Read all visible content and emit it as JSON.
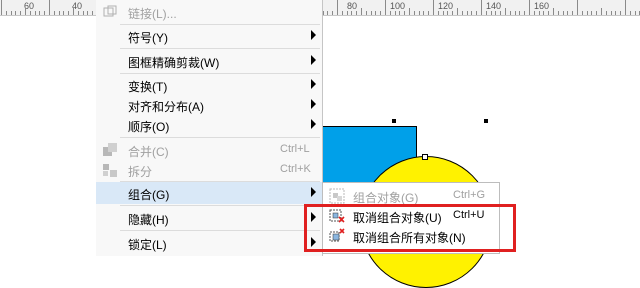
{
  "ruler": {
    "labels": [
      "60",
      "40",
      "80",
      "100",
      "120",
      "140",
      "160"
    ]
  },
  "menu": {
    "items": [
      {
        "label": "链接(L)..."
      },
      {
        "label": "符号(Y)"
      },
      {
        "label": "图框精确剪裁(W)"
      },
      {
        "label": "变换(T)"
      },
      {
        "label": "对齐和分布(A)"
      },
      {
        "label": "顺序(O)"
      },
      {
        "label": "合并(C)",
        "shortcut": "Ctrl+L"
      },
      {
        "label": "拆分",
        "shortcut": "Ctrl+K"
      },
      {
        "label": "组合(G)"
      },
      {
        "label": "隐藏(H)"
      },
      {
        "label": "锁定(L)"
      }
    ]
  },
  "submenu": {
    "items": [
      {
        "label": "组合对象(G)",
        "shortcut": "Ctrl+G"
      },
      {
        "label": "取消组合对象(U)",
        "shortcut": "Ctrl+U"
      },
      {
        "label": "取消组合所有对象(N)"
      }
    ]
  },
  "colors": {
    "accent": "#e02020",
    "shape_blue": "#00a0e9",
    "shape_yellow": "#fff200",
    "hover": "#d9e8f7"
  }
}
